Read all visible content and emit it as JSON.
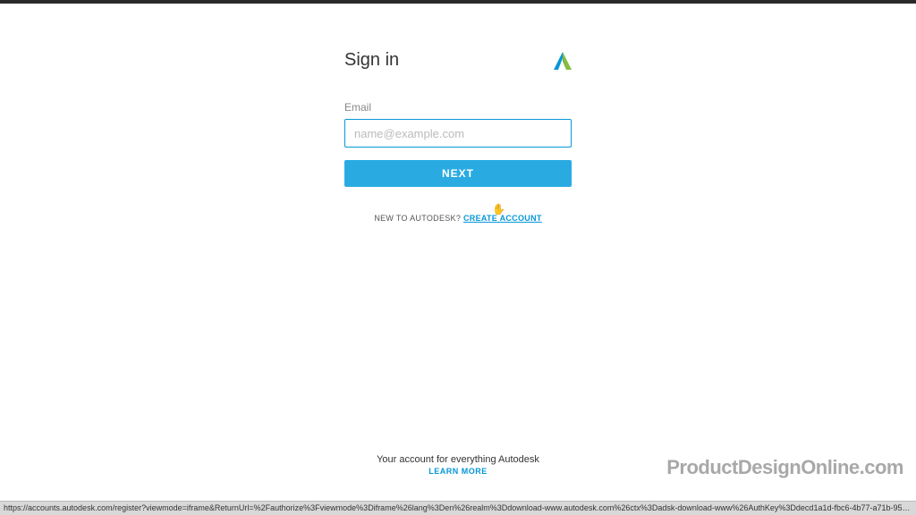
{
  "signin": {
    "title": "Sign in",
    "email_label": "Email",
    "email_placeholder": "name@example.com",
    "next_button": "NEXT",
    "new_prompt": "NEW TO AUTODESK? ",
    "create_link": "CREATE ACCOUNT"
  },
  "footer": {
    "tagline": "Your account for everything Autodesk",
    "learn_more": "LEARN MORE"
  },
  "watermark": "ProductDesignOnline.com",
  "status_url": "https://accounts.autodesk.com/register?viewmode=iframe&ReturnUrl=%2Fauthorize%3Fviewmode%3Diframe%26lang%3Den%26realm%3Ddownload-www.autodesk.com%26ctx%3Dadsk-download-www%26AuthKey%3Ddecd1a1d-fbc6-4b77-a71b-950cc9..."
}
